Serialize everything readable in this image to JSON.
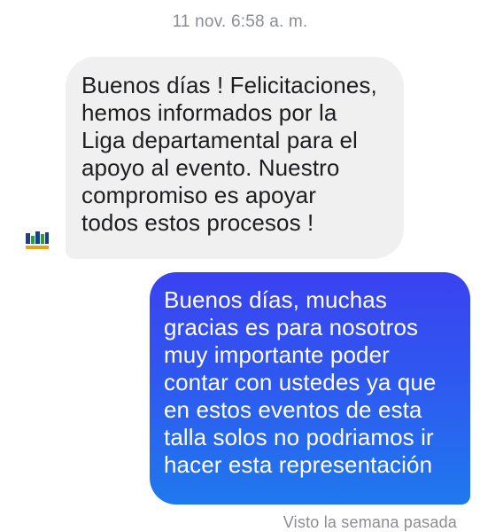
{
  "conversation": {
    "timestamp": "11 nov. 6:58 a. m.",
    "incoming": {
      "avatar_icon": "team-logo-icon",
      "text": "Buenos días ! Felicitaciones,\nhemos informados por  la\nLiga departamental para el\napoyo al evento. Nuestro\ncompromiso es apoyar\ntodos estos procesos !"
    },
    "outgoing": {
      "text": "Buenos días, muchas\ngracias es para nosotros\nmuy importante poder\ncontar con ustedes ya que\nen estos eventos de esta\ntalla solos no podriamos ir\nhacer esta representación"
    },
    "seen_status": "Visto la semana pasada"
  },
  "colors": {
    "incoming_bubble": "#f0f0f0",
    "outgoing_bubble_top": "#3a42f0",
    "outgoing_bubble_bottom": "#1f79ee",
    "meta_text": "#8a8d91"
  }
}
